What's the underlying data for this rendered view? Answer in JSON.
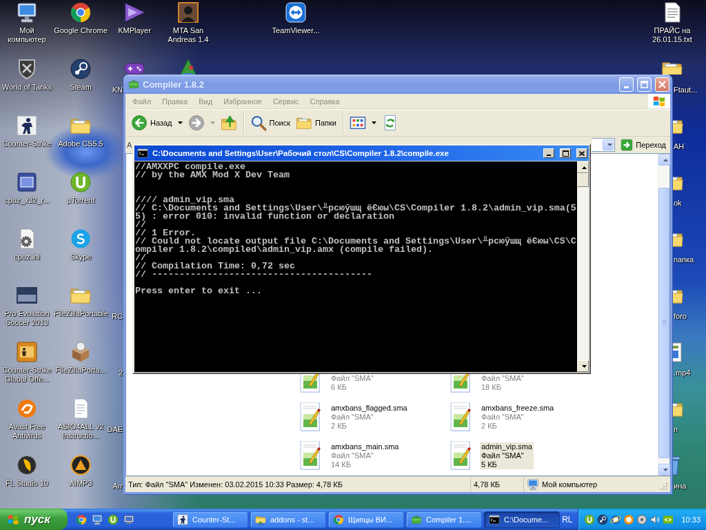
{
  "desktop": {
    "columns": [
      [
        {
          "label": "Мой компьютер",
          "kind": "computer"
        },
        {
          "label": "World of Tanks",
          "kind": "emblem"
        },
        {
          "label": "Counter-Strike",
          "kind": "soldier"
        },
        {
          "label": "cpuz_x32_r...",
          "kind": "chip"
        },
        {
          "label": "cpuz.ini",
          "kind": "settings-file"
        },
        {
          "label": "Pro Evolution Soccer 2013",
          "kind": "cover"
        },
        {
          "label": "Counter-Strike Global Offe...",
          "kind": "go-tile"
        },
        {
          "label": "Avast Free Antivirus",
          "kind": "swirl"
        },
        {
          "label": "FL Studio 10",
          "kind": "fruit"
        }
      ],
      [
        {
          "label": "Google Chrome",
          "kind": "tricolor"
        },
        {
          "label": "Steam",
          "kind": "piston"
        },
        {
          "label": "Adobe CS5.5",
          "kind": "folder"
        },
        {
          "label": "µTorrent",
          "kind": "hook"
        },
        {
          "label": "Skype",
          "kind": "cloud"
        },
        {
          "label": "FileZillaPortable",
          "kind": "folder"
        },
        {
          "label": "FileZillaPorta...",
          "kind": "box"
        },
        {
          "label": "ASIO4ALL v2 Instructio...",
          "kind": "document"
        },
        {
          "label": "AIMP3",
          "kind": "triangle-disc"
        }
      ],
      [
        {
          "label": "KMPlayer",
          "kind": "play"
        },
        {
          "label": "KN",
          "kind": "gamepad"
        },
        null,
        null,
        null,
        {
          "label": "RC"
        },
        {
          "label": "2"
        },
        {
          "label": "DAE"
        },
        {
          "label": "Arr"
        }
      ],
      [
        {
          "label": "MTA San Andreas 1.4",
          "kind": "portrait"
        },
        {
          "kind": "pyramid"
        }
      ],
      null,
      [
        {
          "label": "TeamViewer...",
          "kind": "arrows-tile"
        }
      ]
    ],
    "right_column": [
      {
        "label": "ПРАЙС на 26.01.15.txt",
        "kind": "text-file"
      },
      {
        "label": "Ftaut...",
        "kind": "folder"
      },
      {
        "label": "АН",
        "kind": "folder"
      },
      {
        "label": "ok",
        "kind": "folder"
      },
      {
        "label": "папка",
        "kind": "folder"
      },
      {
        "label": "foro",
        "kind": "folder"
      },
      {
        "label": ".mp4",
        "kind": "media-file"
      },
      {
        "label": "п",
        "kind": "folder"
      },
      {
        "label": "ина",
        "kind": "bin"
      }
    ]
  },
  "explorer": {
    "title": "Compiler 1.8.2",
    "menu": [
      "Файл",
      "Правка",
      "Вид",
      "Избранное",
      "Сервис",
      "Справка"
    ],
    "toolbar": [
      [
        {
          "kind": "back",
          "label": "Назад",
          "disabled": false
        },
        {
          "kind": "forward",
          "disabled": true
        },
        {
          "kind": "up",
          "disabled": false
        }
      ],
      [
        {
          "kind": "search",
          "label": "Поиск",
          "disabled": false
        },
        {
          "kind": "folders",
          "label": "Папки",
          "disabled": false
        }
      ],
      [
        {
          "kind": "views",
          "disabled": false
        },
        {
          "kind": "refresh",
          "disabled": false
        }
      ]
    ],
    "address_label": "А",
    "go_button": "Переход",
    "files": [
      {
        "type": "Файл \"SMA\"",
        "size": "6 КБ",
        "selected": false
      },
      {
        "type": "Файл \"SMA\"",
        "size": "18 КБ",
        "selected": false
      },
      {
        "name": "amxbans_flagged.sma",
        "type": "Файл \"SMA\"",
        "size": "2 КБ",
        "selected": false
      },
      {
        "name": "amxbans_freeze.sma",
        "type": "Файл \"SMA\"",
        "size": "2 КБ",
        "selected": false
      },
      {
        "name": "amxbans_main.sma",
        "type": "Файл \"SMA\"",
        "size": "14 КБ",
        "selected": false
      },
      {
        "name": "admin_vip.sma",
        "type": "Файл \"SMA\"",
        "size": "5 КБ",
        "selected": true
      }
    ],
    "status_bar": {
      "details": "Тип: Файл \"SMA\" Изменен: 03.02.2015 10:33 Размер: 4,78 КБ",
      "size": "4,78 КБ",
      "location": "Мой компьютер"
    }
  },
  "console": {
    "title": "C:\\Documents and Settings\\User\\Рабочий стол\\CS\\Compiler 1.8.2\\compile.exe",
    "lines": [
      {
        "kind": "text",
        "text": "//AMXXPC compile.exe"
      },
      {
        "kind": "text",
        "text": "// by the AMX Mod X Dev Team"
      },
      {
        "kind": "blank"
      },
      {
        "kind": "blank"
      },
      {
        "kind": "text",
        "text": "//// admin_vip.sma"
      },
      {
        "kind": "text",
        "text": "// C:\\Documents and Settings\\User\\╨рсюўшщ ёЄюы\\CS\\Compiler 1.8.2\\admin_vip.sma(5"
      },
      {
        "kind": "text",
        "text": "5) : error 010: invalid function or declaration"
      },
      {
        "kind": "text",
        "text": "//"
      },
      {
        "kind": "text",
        "text": "// 1 Error."
      },
      {
        "kind": "text",
        "text": "// Could not locate output file C:\\Documents and Settings\\User\\╨рсюўшщ ёЄюы\\CS\\C"
      },
      {
        "kind": "text",
        "text": "ompiler 1.8.2\\compiled\\admin_vip.amx (compile failed)."
      },
      {
        "kind": "text",
        "text": "//"
      },
      {
        "kind": "text",
        "text": "// Compilation Time: 0,72 sec"
      },
      {
        "kind": "text",
        "text": "// ----------------------------------------"
      },
      {
        "kind": "blank"
      },
      {
        "kind": "text",
        "text": "Press enter to exit ..."
      }
    ]
  },
  "taskbar": {
    "start": "пуск",
    "tasks": [
      {
        "label": "Counter-St...",
        "kind": "soldier",
        "selected": false
      },
      {
        "label": "addons - st...",
        "kind": "network",
        "selected": false
      },
      {
        "label": "Щипцы ВИ...",
        "kind": "tricolor",
        "selected": false
      },
      {
        "label": "Compiler 1....",
        "kind": "case",
        "selected": false
      },
      {
        "label": "C:\\Docume...",
        "kind": "console",
        "selected": true
      }
    ],
    "language": "RL",
    "clock": "10:33"
  }
}
